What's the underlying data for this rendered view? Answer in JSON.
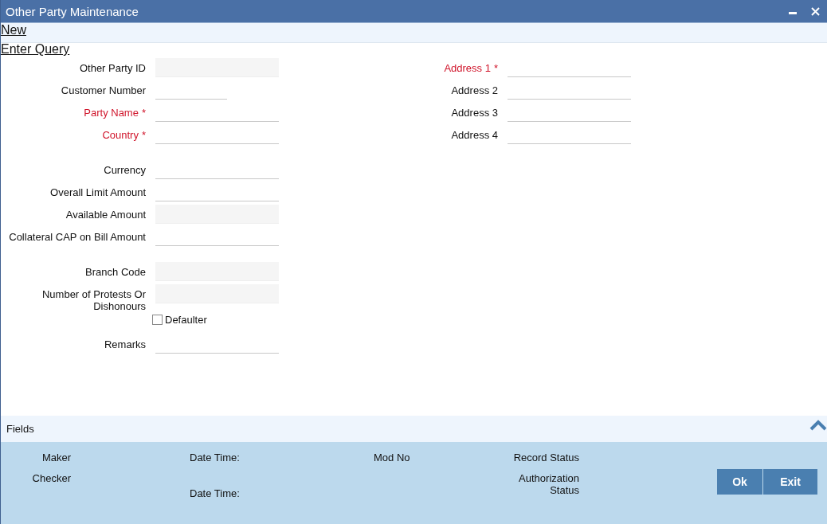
{
  "window": {
    "title": "Other Party Maintenance"
  },
  "actions": [
    "New",
    "Enter Query"
  ],
  "left_groups": [
    [
      {
        "label": "Other Party ID",
        "kind": "readonly",
        "required": false
      },
      {
        "label": "Customer Number",
        "kind": "short",
        "required": false
      },
      {
        "label": "Party Name",
        "kind": "text",
        "required": "*"
      },
      {
        "label": "Country",
        "kind": "text",
        "required": "*"
      }
    ],
    [
      {
        "label": "Currency",
        "kind": "text",
        "required": false
      },
      {
        "label": "Overall Limit Amount",
        "kind": "text",
        "required": false
      },
      {
        "label": "Available Amount",
        "kind": "readonly",
        "required": false
      },
      {
        "label": "Collateral CAP on Bill Amount",
        "kind": "text",
        "required": false
      }
    ],
    [
      {
        "label": "Branch Code",
        "kind": "readonly",
        "required": false
      },
      {
        "label": "Number of Protests Or Dishonours",
        "kind": "readonly",
        "required": false
      },
      {
        "label": "Defaulter",
        "kind": "checkbox",
        "checked": false
      },
      {
        "label": "Remarks",
        "kind": "text",
        "required": false
      }
    ]
  ],
  "right_fields": [
    {
      "label": "Address 1",
      "required": "*"
    },
    {
      "label": "Address 2"
    },
    {
      "label": "Address 3"
    },
    {
      "label": "Address 4"
    }
  ],
  "fields_bar": {
    "label": "Fields"
  },
  "audit": [
    [
      "Maker",
      "Date Time:",
      "Mod No",
      "Record Status"
    ],
    [
      "Checker",
      "Date Time:",
      "Authorization Status"
    ]
  ],
  "buttons": [
    "Ok",
    "Exit"
  ]
}
